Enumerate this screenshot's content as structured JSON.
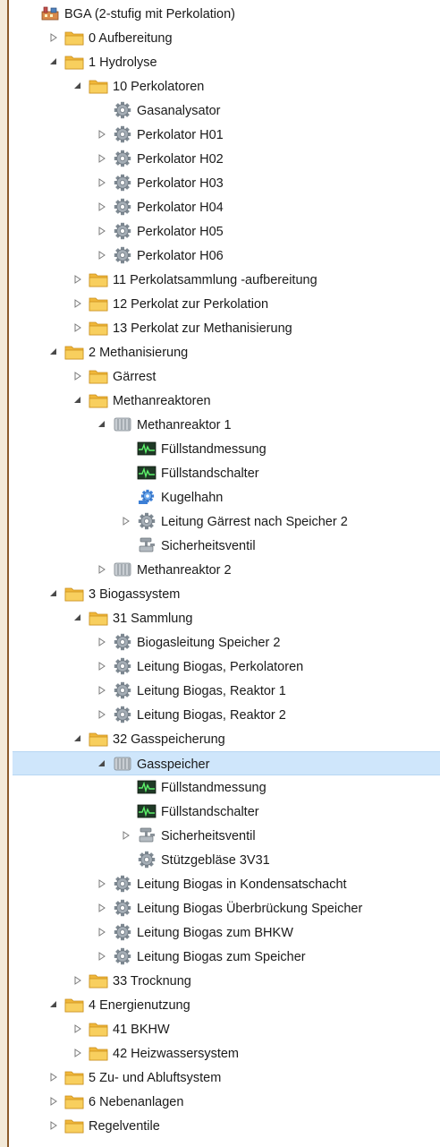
{
  "tree": {
    "nodes": [
      {
        "label": "BGA (2-stufig mit Perkolation)",
        "depth": 0,
        "icon": "plant-icon",
        "toggle": "none"
      },
      {
        "label": "0 Aufbereitung",
        "depth": 1,
        "icon": "folder-icon",
        "toggle": "collapsed"
      },
      {
        "label": "1 Hydrolyse",
        "depth": 1,
        "icon": "folder-icon",
        "toggle": "expanded"
      },
      {
        "label": "10 Perkolatoren",
        "depth": 2,
        "icon": "folder-icon",
        "toggle": "expanded"
      },
      {
        "label": "Gasanalysator",
        "depth": 3,
        "icon": "gear-icon",
        "toggle": "none"
      },
      {
        "label": "Perkolator H01",
        "depth": 3,
        "icon": "gear-icon",
        "toggle": "collapsed"
      },
      {
        "label": "Perkolator H02",
        "depth": 3,
        "icon": "gear-icon",
        "toggle": "collapsed"
      },
      {
        "label": "Perkolator H03",
        "depth": 3,
        "icon": "gear-icon",
        "toggle": "collapsed"
      },
      {
        "label": "Perkolator H04",
        "depth": 3,
        "icon": "gear-icon",
        "toggle": "collapsed"
      },
      {
        "label": "Perkolator H05",
        "depth": 3,
        "icon": "gear-icon",
        "toggle": "collapsed"
      },
      {
        "label": "Perkolator H06",
        "depth": 3,
        "icon": "gear-icon",
        "toggle": "collapsed"
      },
      {
        "label": "11 Perkolatsammlung -aufbereitung",
        "depth": 2,
        "icon": "folder-icon",
        "toggle": "collapsed"
      },
      {
        "label": "12 Perkolat zur Perkolation",
        "depth": 2,
        "icon": "folder-icon",
        "toggle": "collapsed"
      },
      {
        "label": "13 Perkolat zur Methanisierung",
        "depth": 2,
        "icon": "folder-icon",
        "toggle": "collapsed"
      },
      {
        "label": "2 Methanisierung",
        "depth": 1,
        "icon": "folder-icon",
        "toggle": "expanded"
      },
      {
        "label": "Gärrest",
        "depth": 2,
        "icon": "folder-icon",
        "toggle": "collapsed"
      },
      {
        "label": "Methanreaktoren",
        "depth": 2,
        "icon": "folder-icon",
        "toggle": "expanded"
      },
      {
        "label": "Methanreaktor 1",
        "depth": 3,
        "icon": "tank-icon",
        "toggle": "expanded"
      },
      {
        "label": "Füllstandmessung",
        "depth": 4,
        "icon": "monitor-icon",
        "toggle": "none"
      },
      {
        "label": "Füllstandschalter",
        "depth": 4,
        "icon": "monitor-icon",
        "toggle": "none"
      },
      {
        "label": "Kugelhahn",
        "depth": 4,
        "icon": "valve-gear-icon",
        "toggle": "none"
      },
      {
        "label": "Leitung Gärrest nach Speicher 2",
        "depth": 4,
        "icon": "gear-icon",
        "toggle": "collapsed"
      },
      {
        "label": "Sicherheitsventil",
        "depth": 4,
        "icon": "safety-valve-icon",
        "toggle": "none"
      },
      {
        "label": "Methanreaktor 2",
        "depth": 3,
        "icon": "tank-icon",
        "toggle": "collapsed"
      },
      {
        "label": "3 Biogassystem",
        "depth": 1,
        "icon": "folder-icon",
        "toggle": "expanded"
      },
      {
        "label": "31 Sammlung",
        "depth": 2,
        "icon": "folder-icon",
        "toggle": "expanded"
      },
      {
        "label": "Biogasleitung Speicher 2",
        "depth": 3,
        "icon": "gear-icon",
        "toggle": "collapsed"
      },
      {
        "label": "Leitung Biogas, Perkolatoren",
        "depth": 3,
        "icon": "gear-icon",
        "toggle": "collapsed"
      },
      {
        "label": "Leitung Biogas, Reaktor 1",
        "depth": 3,
        "icon": "gear-icon",
        "toggle": "collapsed"
      },
      {
        "label": "Leitung Biogas, Reaktor 2",
        "depth": 3,
        "icon": "gear-icon",
        "toggle": "collapsed"
      },
      {
        "label": "32 Gasspeicherung",
        "depth": 2,
        "icon": "folder-icon",
        "toggle": "expanded"
      },
      {
        "label": "Gasspeicher",
        "depth": 3,
        "icon": "tank-icon",
        "toggle": "expanded",
        "selected": true
      },
      {
        "label": "Füllstandmessung",
        "depth": 4,
        "icon": "monitor-icon",
        "toggle": "none"
      },
      {
        "label": "Füllstandschalter",
        "depth": 4,
        "icon": "monitor-icon",
        "toggle": "none"
      },
      {
        "label": "Sicherheitsventil",
        "depth": 4,
        "icon": "safety-valve-icon",
        "toggle": "collapsed"
      },
      {
        "label": "Stützgebläse 3V31",
        "depth": 4,
        "icon": "gear-icon",
        "toggle": "none"
      },
      {
        "label": "Leitung Biogas in Kondensatschacht",
        "depth": 3,
        "icon": "gear-icon",
        "toggle": "collapsed"
      },
      {
        "label": "Leitung Biogas Überbrückung Speicher",
        "depth": 3,
        "icon": "gear-icon",
        "toggle": "collapsed"
      },
      {
        "label": "Leitung Biogas zum BHKW",
        "depth": 3,
        "icon": "gear-icon",
        "toggle": "collapsed"
      },
      {
        "label": "Leitung Biogas zum Speicher",
        "depth": 3,
        "icon": "gear-icon",
        "toggle": "collapsed"
      },
      {
        "label": "33 Trocknung",
        "depth": 2,
        "icon": "folder-icon",
        "toggle": "collapsed"
      },
      {
        "label": "4 Energienutzung",
        "depth": 1,
        "icon": "folder-icon",
        "toggle": "expanded"
      },
      {
        "label": "41 BKHW",
        "depth": 2,
        "icon": "folder-icon",
        "toggle": "collapsed"
      },
      {
        "label": "42 Heizwassersystem",
        "depth": 2,
        "icon": "folder-icon",
        "toggle": "collapsed"
      },
      {
        "label": "5 Zu- und Abluftsystem",
        "depth": 1,
        "icon": "folder-icon",
        "toggle": "collapsed"
      },
      {
        "label": "6 Nebenanlagen",
        "depth": 1,
        "icon": "folder-icon",
        "toggle": "collapsed"
      },
      {
        "label": "Regelventile",
        "depth": 1,
        "icon": "folder-icon",
        "toggle": "collapsed"
      }
    ]
  },
  "colors": {
    "selection": "#cfe6fb",
    "folder": "#f5c34a",
    "frame": "#8a5a2b"
  }
}
